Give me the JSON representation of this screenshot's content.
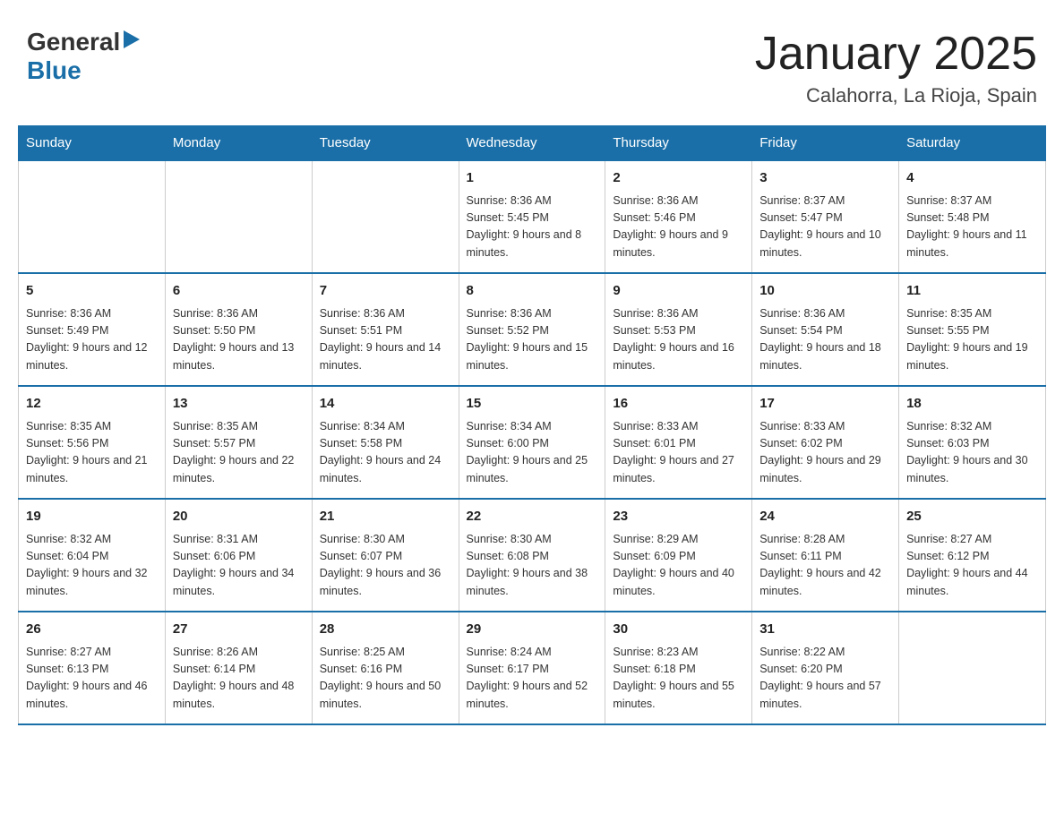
{
  "logo": {
    "general": "General",
    "blue": "Blue"
  },
  "header": {
    "title": "January 2025",
    "subtitle": "Calahorra, La Rioja, Spain"
  },
  "days_of_week": [
    "Sunday",
    "Monday",
    "Tuesday",
    "Wednesday",
    "Thursday",
    "Friday",
    "Saturday"
  ],
  "weeks": [
    [
      {
        "day": "",
        "info": ""
      },
      {
        "day": "",
        "info": ""
      },
      {
        "day": "",
        "info": ""
      },
      {
        "day": "1",
        "info": "Sunrise: 8:36 AM\nSunset: 5:45 PM\nDaylight: 9 hours and 8 minutes."
      },
      {
        "day": "2",
        "info": "Sunrise: 8:36 AM\nSunset: 5:46 PM\nDaylight: 9 hours and 9 minutes."
      },
      {
        "day": "3",
        "info": "Sunrise: 8:37 AM\nSunset: 5:47 PM\nDaylight: 9 hours and 10 minutes."
      },
      {
        "day": "4",
        "info": "Sunrise: 8:37 AM\nSunset: 5:48 PM\nDaylight: 9 hours and 11 minutes."
      }
    ],
    [
      {
        "day": "5",
        "info": "Sunrise: 8:36 AM\nSunset: 5:49 PM\nDaylight: 9 hours and 12 minutes."
      },
      {
        "day": "6",
        "info": "Sunrise: 8:36 AM\nSunset: 5:50 PM\nDaylight: 9 hours and 13 minutes."
      },
      {
        "day": "7",
        "info": "Sunrise: 8:36 AM\nSunset: 5:51 PM\nDaylight: 9 hours and 14 minutes."
      },
      {
        "day": "8",
        "info": "Sunrise: 8:36 AM\nSunset: 5:52 PM\nDaylight: 9 hours and 15 minutes."
      },
      {
        "day": "9",
        "info": "Sunrise: 8:36 AM\nSunset: 5:53 PM\nDaylight: 9 hours and 16 minutes."
      },
      {
        "day": "10",
        "info": "Sunrise: 8:36 AM\nSunset: 5:54 PM\nDaylight: 9 hours and 18 minutes."
      },
      {
        "day": "11",
        "info": "Sunrise: 8:35 AM\nSunset: 5:55 PM\nDaylight: 9 hours and 19 minutes."
      }
    ],
    [
      {
        "day": "12",
        "info": "Sunrise: 8:35 AM\nSunset: 5:56 PM\nDaylight: 9 hours and 21 minutes."
      },
      {
        "day": "13",
        "info": "Sunrise: 8:35 AM\nSunset: 5:57 PM\nDaylight: 9 hours and 22 minutes."
      },
      {
        "day": "14",
        "info": "Sunrise: 8:34 AM\nSunset: 5:58 PM\nDaylight: 9 hours and 24 minutes."
      },
      {
        "day": "15",
        "info": "Sunrise: 8:34 AM\nSunset: 6:00 PM\nDaylight: 9 hours and 25 minutes."
      },
      {
        "day": "16",
        "info": "Sunrise: 8:33 AM\nSunset: 6:01 PM\nDaylight: 9 hours and 27 minutes."
      },
      {
        "day": "17",
        "info": "Sunrise: 8:33 AM\nSunset: 6:02 PM\nDaylight: 9 hours and 29 minutes."
      },
      {
        "day": "18",
        "info": "Sunrise: 8:32 AM\nSunset: 6:03 PM\nDaylight: 9 hours and 30 minutes."
      }
    ],
    [
      {
        "day": "19",
        "info": "Sunrise: 8:32 AM\nSunset: 6:04 PM\nDaylight: 9 hours and 32 minutes."
      },
      {
        "day": "20",
        "info": "Sunrise: 8:31 AM\nSunset: 6:06 PM\nDaylight: 9 hours and 34 minutes."
      },
      {
        "day": "21",
        "info": "Sunrise: 8:30 AM\nSunset: 6:07 PM\nDaylight: 9 hours and 36 minutes."
      },
      {
        "day": "22",
        "info": "Sunrise: 8:30 AM\nSunset: 6:08 PM\nDaylight: 9 hours and 38 minutes."
      },
      {
        "day": "23",
        "info": "Sunrise: 8:29 AM\nSunset: 6:09 PM\nDaylight: 9 hours and 40 minutes."
      },
      {
        "day": "24",
        "info": "Sunrise: 8:28 AM\nSunset: 6:11 PM\nDaylight: 9 hours and 42 minutes."
      },
      {
        "day": "25",
        "info": "Sunrise: 8:27 AM\nSunset: 6:12 PM\nDaylight: 9 hours and 44 minutes."
      }
    ],
    [
      {
        "day": "26",
        "info": "Sunrise: 8:27 AM\nSunset: 6:13 PM\nDaylight: 9 hours and 46 minutes."
      },
      {
        "day": "27",
        "info": "Sunrise: 8:26 AM\nSunset: 6:14 PM\nDaylight: 9 hours and 48 minutes."
      },
      {
        "day": "28",
        "info": "Sunrise: 8:25 AM\nSunset: 6:16 PM\nDaylight: 9 hours and 50 minutes."
      },
      {
        "day": "29",
        "info": "Sunrise: 8:24 AM\nSunset: 6:17 PM\nDaylight: 9 hours and 52 minutes."
      },
      {
        "day": "30",
        "info": "Sunrise: 8:23 AM\nSunset: 6:18 PM\nDaylight: 9 hours and 55 minutes."
      },
      {
        "day": "31",
        "info": "Sunrise: 8:22 AM\nSunset: 6:20 PM\nDaylight: 9 hours and 57 minutes."
      },
      {
        "day": "",
        "info": ""
      }
    ]
  ]
}
